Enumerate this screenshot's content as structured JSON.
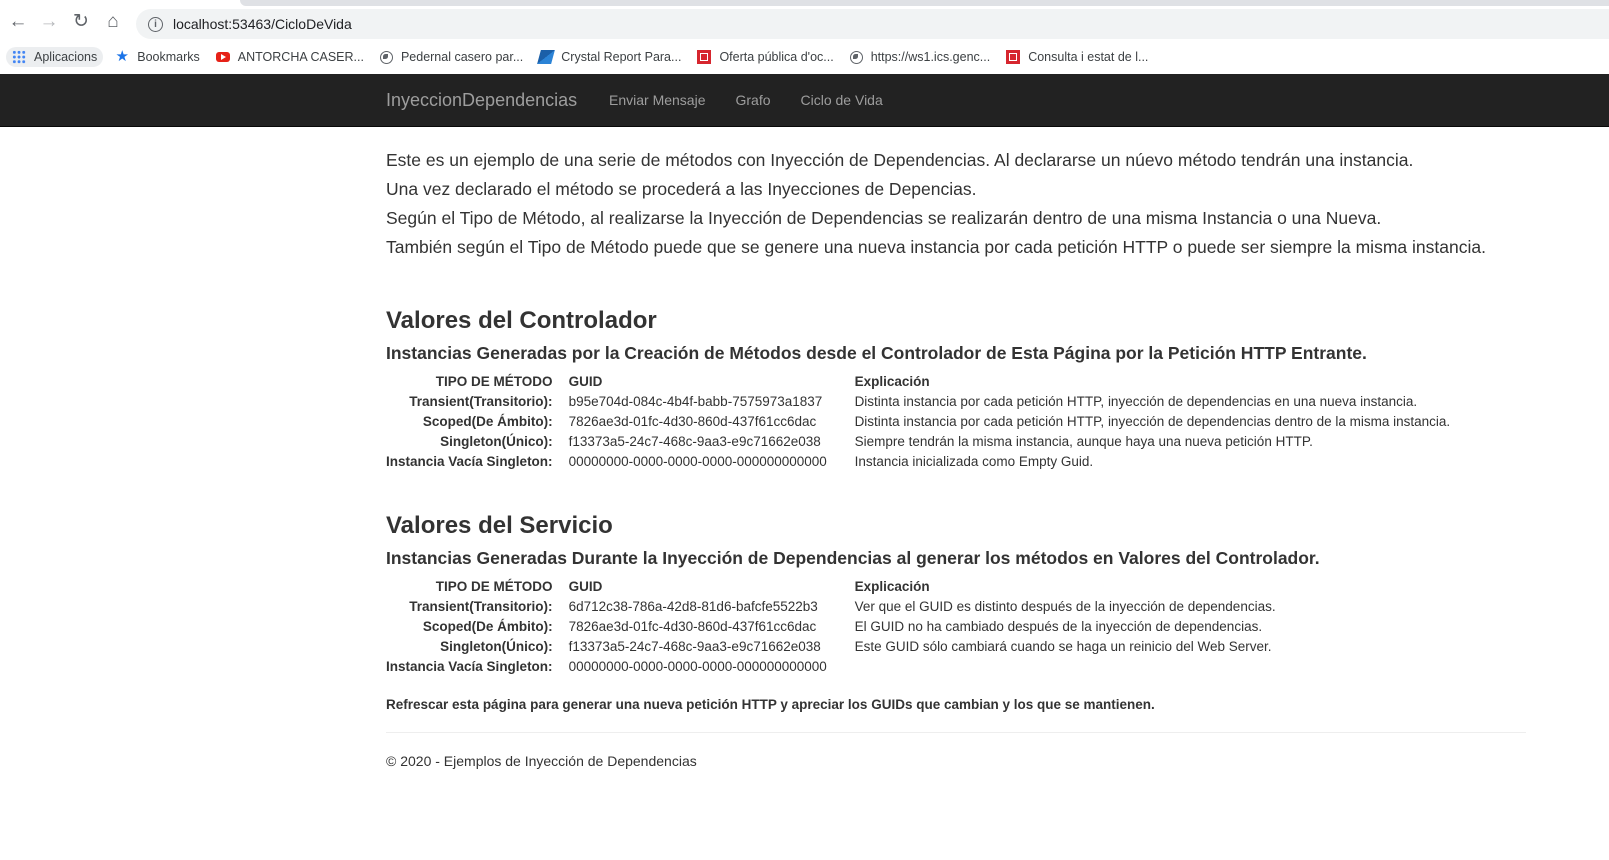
{
  "browser": {
    "url": "localhost:53463/CicloDeVida",
    "bookmarks": [
      {
        "label": "Aplicacions",
        "icon": "apps-grid-icon"
      },
      {
        "label": "Bookmarks",
        "icon": "star-icon"
      },
      {
        "label": "ANTORCHA CASER...",
        "icon": "youtube-icon"
      },
      {
        "label": "Pedernal casero par...",
        "icon": "globe-icon"
      },
      {
        "label": "Crystal Report Para...",
        "icon": "crystal-report-icon"
      },
      {
        "label": "Oferta pública d'oc...",
        "icon": "generalitat-icon"
      },
      {
        "label": "https://ws1.ics.genc...",
        "icon": "globe-icon"
      },
      {
        "label": "Consulta i estat de l...",
        "icon": "generalitat-icon"
      }
    ]
  },
  "navbar": {
    "brand": "InyeccionDependencias",
    "links": [
      "Enviar Mensaje",
      "Grafo",
      "Ciclo de Vida"
    ]
  },
  "intro": [
    "Este es un ejemplo de una serie de métodos con Inyección de Dependencias. Al declararse un núevo método tendrán una instancia.",
    "Una vez declarado el método se procederá a las Inyecciones de Depencias.",
    "Según el Tipo de Método, al realizarse la Inyección de Dependencias se realizarán dentro de una misma Instancia o una Nueva.",
    "También según el Tipo de Método puede que se genere una nueva instancia por cada petición HTTP o puede ser siempre la misma instancia."
  ],
  "controller": {
    "title": "Valores del Controlador",
    "subtitle": "Instancias Generadas por la Creación de Métodos desde el Controlador de Esta Página por la Petición HTTP Entrante.",
    "headers": [
      "TIPO DE MÉTODO",
      "GUID",
      "Explicación"
    ],
    "rows": [
      [
        "Transient(Transitorio):",
        "b95e704d-084c-4b4f-babb-7575973a1837",
        "Distinta instancia por cada petición HTTP, inyección de dependencias en una nueva instancia."
      ],
      [
        "Scoped(De Ámbito):",
        "7826ae3d-01fc-4d30-860d-437f61cc6dac",
        "Distinta instancia por cada petición HTTP, inyección de dependencias dentro de la misma instancia."
      ],
      [
        "Singleton(Único):",
        "f13373a5-24c7-468c-9aa3-e9c71662e038",
        "Siempre tendrán la misma instancia, aunque haya una nueva petición HTTP."
      ],
      [
        "Instancia Vacía Singleton:",
        "00000000-0000-0000-0000-000000000000",
        "Instancia inicializada como Empty Guid."
      ]
    ]
  },
  "service": {
    "title": "Valores del Servicio",
    "subtitle": "Instancias Generadas Durante la Inyección de Dependencias al generar los métodos en Valores del Controlador.",
    "headers": [
      "TIPO DE MÉTODO",
      "GUID",
      "Explicación"
    ],
    "rows": [
      [
        "Transient(Transitorio):",
        "6d712c38-786a-42d8-81d6-bafcfe5522b3",
        "Ver que el GUID es distinto después de la inyección de dependencias."
      ],
      [
        "Scoped(De Ámbito):",
        "7826ae3d-01fc-4d30-860d-437f61cc6dac",
        "El GUID no ha cambiado después de la inyección de dependencias."
      ],
      [
        "Singleton(Único):",
        "f13373a5-24c7-468c-9aa3-e9c71662e038",
        "Este GUID sólo cambiará cuando se haga un reinicio del Web Server."
      ],
      [
        "Instancia Vacía Singleton:",
        "00000000-0000-0000-0000-000000000000",
        ""
      ]
    ]
  },
  "refresh_note": "Refrescar esta página para generar una nueva petición HTTP y apreciar los GUIDs que cambian y los que se mantienen.",
  "footer": "© 2020 - Ejemplos de Inyección de Dependencias"
}
